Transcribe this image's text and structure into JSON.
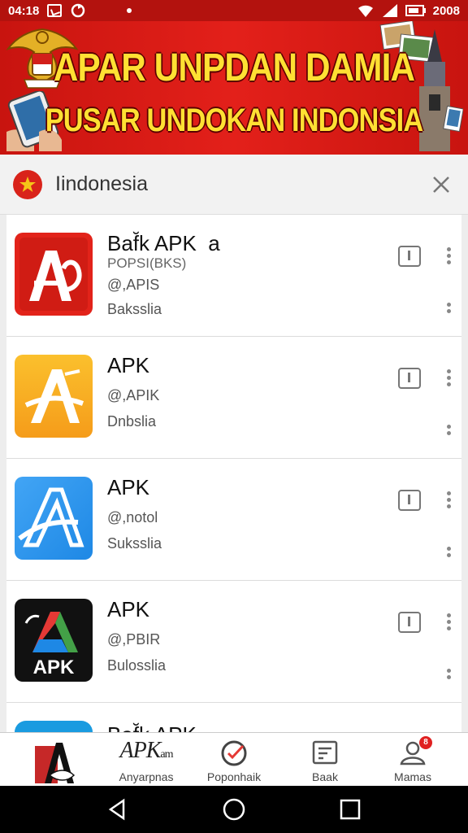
{
  "status_bar": {
    "time": "04:18",
    "battery": "2008"
  },
  "banner": {
    "line1": "APAR UNPDAN DAMIA",
    "line2": "PUSAR UNDOKAN INDONSIA"
  },
  "country_bar": {
    "label": "Iindonesia"
  },
  "apps": [
    {
      "title": "Baf̆k APK  a",
      "lines": [
        "POPSI(BKS)",
        "@,APIS",
        "Baksslia"
      ],
      "icon_text": ""
    },
    {
      "title": "APK",
      "lines": [
        "@,APIK",
        "Dnbslia"
      ],
      "icon_text": ""
    },
    {
      "title": "APK",
      "lines": [
        "@,notol",
        "Suksslia"
      ],
      "icon_text": ""
    },
    {
      "title": "APK",
      "lines": [
        "@,PBIR",
        "Bulosslia"
      ],
      "icon_text": "APK"
    },
    {
      "title": "Baf̆k APK",
      "lines": [],
      "icon_text": ""
    }
  ],
  "bottom_nav": {
    "brand": "APK",
    "brand_suffix": "am",
    "items": [
      {
        "label": "Anyarpnas"
      },
      {
        "label": "Poponhaik"
      },
      {
        "label": "Baak"
      },
      {
        "label": "Mamas",
        "badge": "8"
      }
    ]
  },
  "colors": {
    "status_bar": "#b3120e",
    "banner_red": "#e3201a",
    "banner_text": "#ffe033",
    "icon_red": "#e2231a",
    "icon_yellow": "#f7b320",
    "icon_blue": "#2196f3",
    "icon_black": "#111111"
  }
}
